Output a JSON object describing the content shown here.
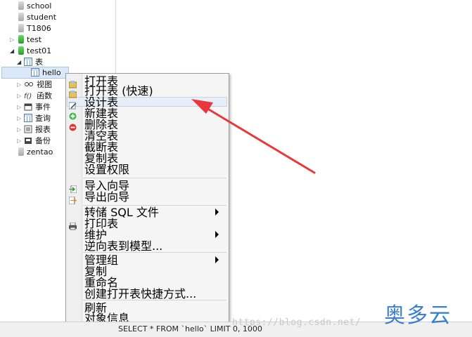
{
  "tree": {
    "items": [
      {
        "label": "school",
        "icon": "database-grey-icon"
      },
      {
        "label": "student",
        "icon": "database-grey-icon"
      },
      {
        "label": "T1806",
        "icon": "database-grey-icon"
      },
      {
        "label": "test",
        "icon": "database-green-icon"
      },
      {
        "label": "test01",
        "icon": "database-green-icon"
      },
      {
        "label": "表",
        "icon": "tables-folder-icon"
      },
      {
        "label": "hello",
        "icon": "table-icon"
      },
      {
        "label": "视图",
        "icon": "views-icon"
      },
      {
        "label": "函数",
        "icon": "function-icon"
      },
      {
        "label": "事件",
        "icon": "event-icon"
      },
      {
        "label": "查询",
        "icon": "query-icon"
      },
      {
        "label": "报表",
        "icon": "report-icon"
      },
      {
        "label": "备份",
        "icon": "backup-icon"
      },
      {
        "label": "zentao",
        "icon": "database-grey-icon"
      }
    ]
  },
  "context_menu": {
    "items": [
      {
        "label": "打开表",
        "icon": "open-table-icon"
      },
      {
        "label": "打开表 (快速)",
        "icon": "open-table-fast-icon"
      },
      {
        "label": "设计表",
        "icon": "design-table-icon"
      },
      {
        "label": "新建表",
        "icon": "new-table-icon"
      },
      {
        "label": "删除表",
        "icon": "delete-table-icon"
      },
      {
        "label": "清空表"
      },
      {
        "label": "截断表"
      },
      {
        "label": "复制表"
      },
      {
        "label": "设置权限"
      },
      {
        "label": "导入向导",
        "icon": "import-icon"
      },
      {
        "label": "导出向导",
        "icon": "export-icon"
      },
      {
        "label": "转储 SQL 文件",
        "submenu": true
      },
      {
        "label": "打印表",
        "icon": "print-icon"
      },
      {
        "label": "维护",
        "submenu": true
      },
      {
        "label": "逆向表到模型..."
      },
      {
        "label": "管理组",
        "submenu": true
      },
      {
        "label": "复制"
      },
      {
        "label": "重命名"
      },
      {
        "label": "创建打开表快捷方式..."
      },
      {
        "label": "刷新"
      },
      {
        "label": "对象信息"
      }
    ]
  },
  "status_bar": {
    "query": "SELECT * FROM `hello` LIMIT 0, 1000"
  },
  "watermark": "https://blog.csdn.net/",
  "brand": "奥多云",
  "colors": {
    "accent_arrow": "#e8383d",
    "brand_blue": "#3a7fd0"
  }
}
